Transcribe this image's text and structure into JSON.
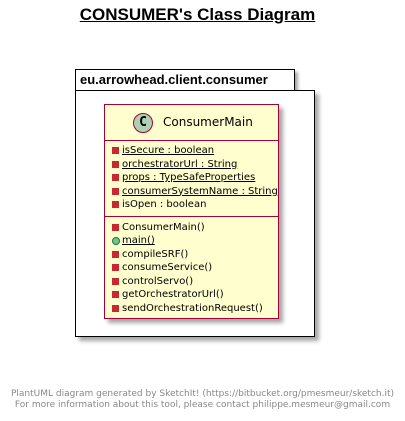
{
  "title": "CONSUMER's Class Diagram",
  "package": {
    "name": "eu.arrowhead.client.consumer"
  },
  "class": {
    "stereotype_letter": "C",
    "name": "ConsumerMain",
    "fields": [
      {
        "visibility": "private",
        "static": true,
        "text": "isSecure : boolean"
      },
      {
        "visibility": "private",
        "static": true,
        "text": "orchestratorUrl : String"
      },
      {
        "visibility": "private",
        "static": true,
        "text": "props : TypeSafeProperties"
      },
      {
        "visibility": "private",
        "static": true,
        "text": "consumerSystemName : String"
      },
      {
        "visibility": "private",
        "static": false,
        "text": "isOpen : boolean"
      }
    ],
    "methods": [
      {
        "visibility": "private",
        "static": false,
        "text": "ConsumerMain()"
      },
      {
        "visibility": "public",
        "static": true,
        "text": "main()"
      },
      {
        "visibility": "private",
        "static": false,
        "text": "compileSRF()"
      },
      {
        "visibility": "private",
        "static": false,
        "text": "consumeService()"
      },
      {
        "visibility": "private",
        "static": false,
        "text": "controlServo()"
      },
      {
        "visibility": "private",
        "static": false,
        "text": "getOrchestratorUrl()"
      },
      {
        "visibility": "private",
        "static": false,
        "text": "sendOrchestrationRequest()"
      }
    ]
  },
  "footer": {
    "line1": "PlantUML diagram generated by SketchIt! (https://bitbucket.org/pmesmeur/sketch.it)",
    "line2": "For more information about this tool, please contact philippe.mesmeur@gmail.com"
  },
  "colors": {
    "class_fill": "#fefece",
    "class_border": "#a80036",
    "class_circle": "#add1b2",
    "private_marker": "#c82930",
    "public_marker": "#84be84"
  }
}
